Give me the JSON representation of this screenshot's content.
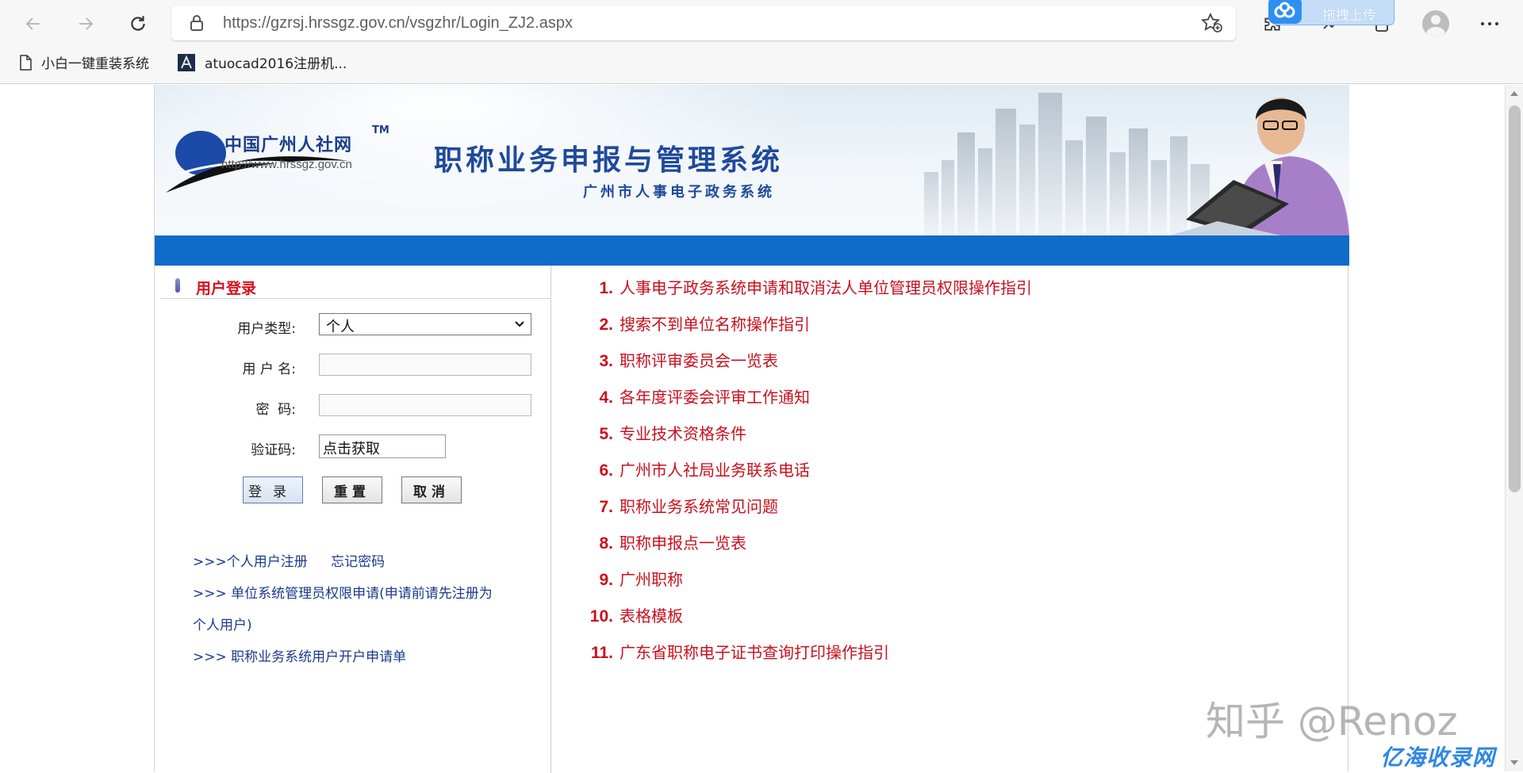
{
  "browser": {
    "url": "https://gzrsj.hrssgz.gov.cn/vsgzhr/Login_ZJ2.aspx",
    "upload_label": "拖拽上传",
    "bookmarks": [
      {
        "label": "小白一键重装系统"
      },
      {
        "label": "atuocad2016注册机..."
      }
    ]
  },
  "banner": {
    "logo_name": "中国广州人社网",
    "logo_tm": "TM",
    "logo_site": "http://www.hrssgz.gov.cn",
    "title": "职称业务申报与管理系统",
    "subtitle": "广州市人事电子政务系统"
  },
  "login": {
    "heading": "用户登录",
    "user_type_label": "用户类型:",
    "user_type_value": "个人",
    "username_label": "用 户 名:",
    "username_value": "",
    "password_label": "密  码:",
    "password_value": "",
    "captcha_label": "验证码:",
    "captcha_value": "点击获取",
    "btn_login": "登录",
    "btn_reset": "重置",
    "btn_cancel": "取消"
  },
  "links": {
    "register": ">>>个人用户注册",
    "forgot": "忘记密码",
    "admin_apply_1": ">>> 单位系统管理员权限申请(申请前请先注册为",
    "admin_apply_2": "个人用户)",
    "open_account": ">>> 职称业务系统用户开户申请单"
  },
  "notices": [
    {
      "num": "1.",
      "text": "人事电子政务系统申请和取消法人单位管理员权限操作指引"
    },
    {
      "num": "2.",
      "text": "搜索不到单位名称操作指引"
    },
    {
      "num": "3.",
      "text": "职称评审委员会一览表"
    },
    {
      "num": "4.",
      "text": "各年度评委会评审工作通知"
    },
    {
      "num": "5.",
      "text": "专业技术资格条件"
    },
    {
      "num": "6.",
      "text": "广州市人社局业务联系电话"
    },
    {
      "num": "7.",
      "text": "职称业务系统常见问题"
    },
    {
      "num": "8.",
      "text": "职称申报点一览表"
    },
    {
      "num": "9.",
      "text": "广州职称"
    },
    {
      "num": "10.",
      "text": "表格模板"
    },
    {
      "num": "11.",
      "text": "广东省职称电子证书查询打印操作指引"
    }
  ],
  "overlay": {
    "watermark": "知乎 @Renoz",
    "corner_logo": "亿海收录网"
  },
  "colors": {
    "accent_blue": "#0f6cc8",
    "notice_red": "#c8101d",
    "link_blue": "#1a3a8c",
    "heading_red": "#d8101d"
  },
  "icons": [
    "back-icon",
    "forward-icon",
    "refresh-icon",
    "lock-icon",
    "favorite-add-icon",
    "extensions-icon",
    "cloud-upload-icon",
    "profile-icon",
    "more-icon",
    "page-icon",
    "autocad-icon",
    "chevron-down-icon"
  ]
}
